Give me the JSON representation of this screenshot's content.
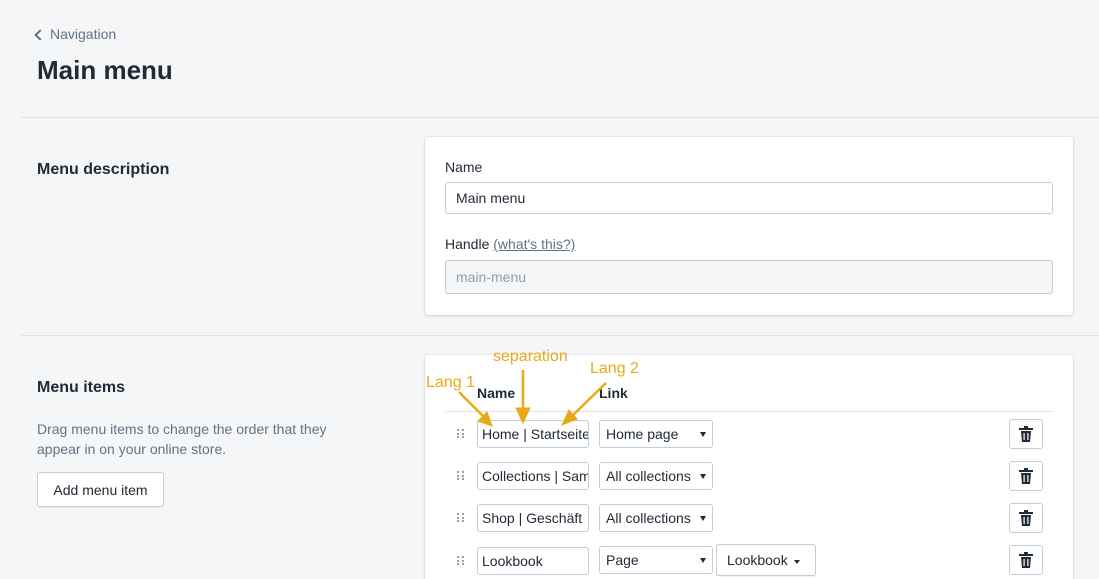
{
  "header": {
    "back_label": "Navigation",
    "title": "Main menu"
  },
  "menu_description": {
    "section_title": "Menu description",
    "name_label": "Name",
    "name_value": "Main menu",
    "handle_label": "Handle",
    "handle_help": "(what's this?)",
    "handle_value": "main-menu"
  },
  "menu_items": {
    "section_title": "Menu items",
    "description": "Drag menu items to change the order that they appear in on your online store.",
    "add_button": "Add menu item",
    "col_name": "Name",
    "col_link": "Link",
    "rows": [
      {
        "name": "Home | Startseite",
        "link": "Home page"
      },
      {
        "name": "Collections | Sammlungen",
        "link": "All collections"
      },
      {
        "name": "Shop |  Geschäft",
        "link": "All collections"
      },
      {
        "name": "Lookbook",
        "link": "Page",
        "page": "Lookbook"
      }
    ]
  },
  "annotations": {
    "lang1": "Lang 1",
    "separation": "separation",
    "lang2": "Lang 2",
    "color": "#e8a917"
  },
  "icons": {
    "back": "chevron-left-icon",
    "drag": "drag-handle-icon",
    "delete": "trash-icon"
  }
}
